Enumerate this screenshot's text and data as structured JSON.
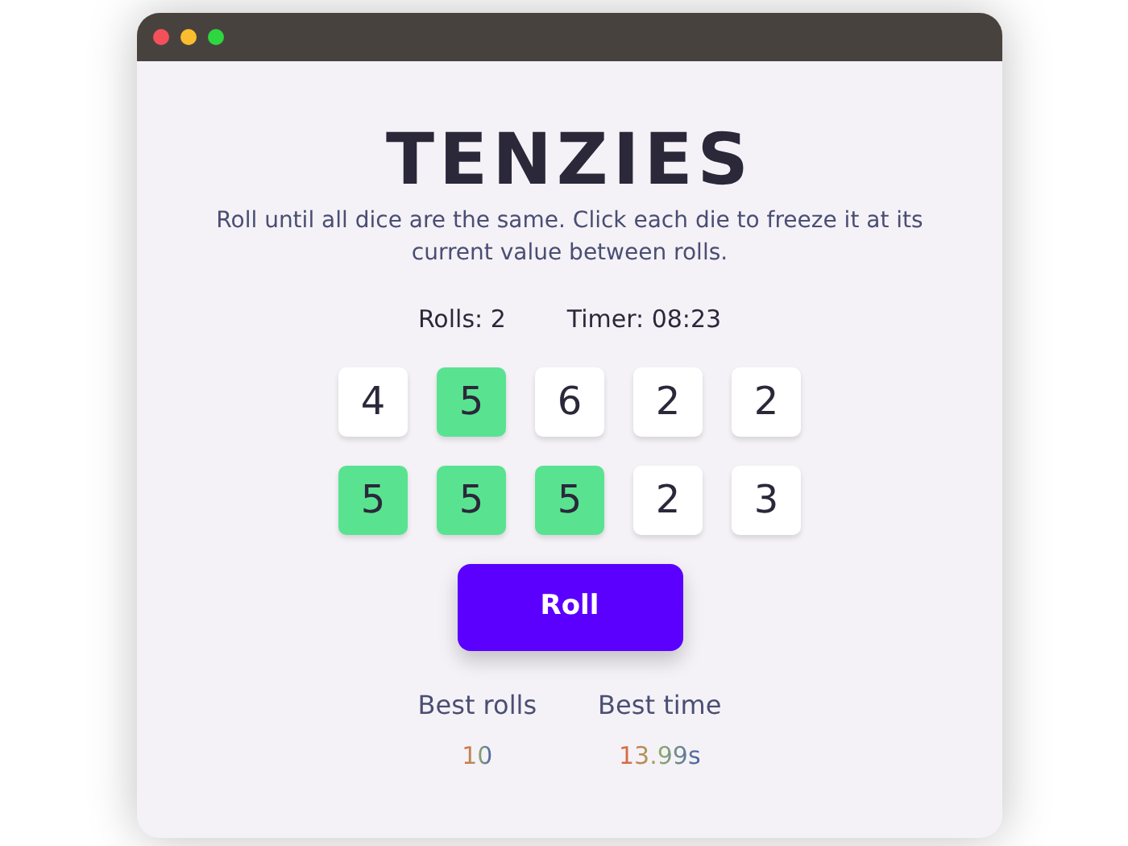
{
  "title": "TENZIES",
  "instructions": "Roll until all dice are the same. Click each die to freeze it at its current value between rolls.",
  "stats": [
    {
      "label": "Rolls: 2"
    },
    {
      "label": "Timer: 08:23"
    }
  ],
  "dice": [
    {
      "value": "4",
      "held": false
    },
    {
      "value": "5",
      "held": true
    },
    {
      "value": "6",
      "held": false
    },
    {
      "value": "2",
      "held": false
    },
    {
      "value": "2",
      "held": false
    },
    {
      "value": "5",
      "held": true
    },
    {
      "value": "5",
      "held": true
    },
    {
      "value": "5",
      "held": true
    },
    {
      "value": "2",
      "held": false
    },
    {
      "value": "3",
      "held": false
    }
  ],
  "roll_button": "Roll",
  "records": [
    {
      "label": "Best rolls",
      "value": "10"
    },
    {
      "label": "Best time",
      "value": "13.99s"
    }
  ]
}
